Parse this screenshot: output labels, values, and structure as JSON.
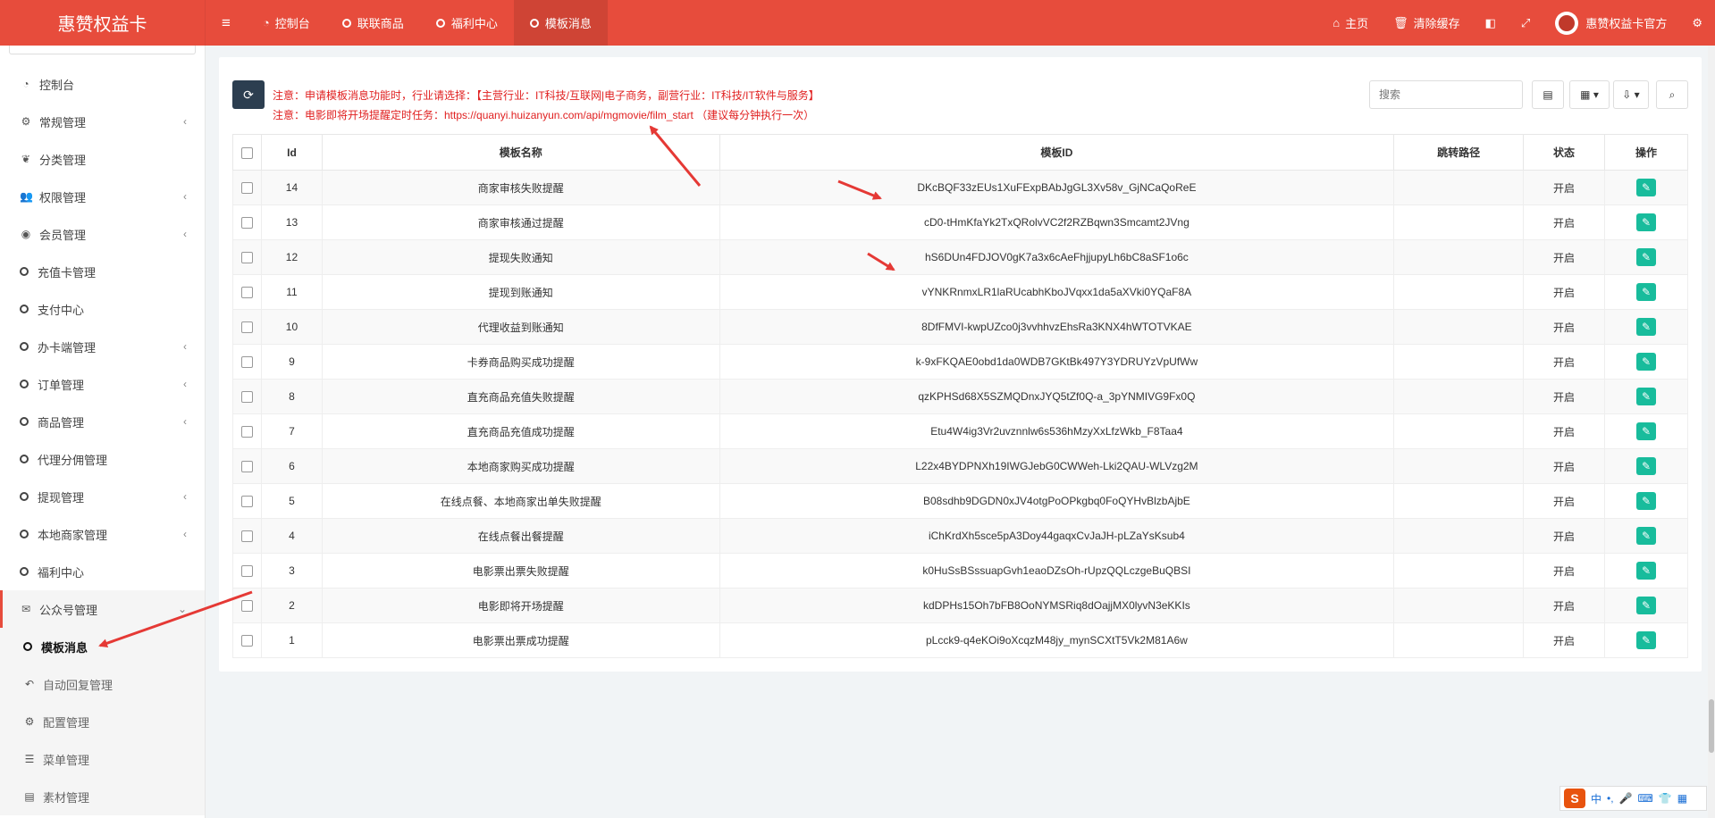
{
  "brand": {
    "title": "惠赞权益卡"
  },
  "topnav": {
    "toggle_icon": "≡",
    "items": [
      {
        "label": "控制台",
        "icon": "dashboard-icon"
      },
      {
        "label": "联联商品",
        "icon": "circle-icon"
      },
      {
        "label": "福利中心",
        "icon": "circle-icon"
      },
      {
        "label": "模板消息",
        "icon": "circle-icon",
        "active": true
      }
    ]
  },
  "topright": {
    "home": "主页",
    "clear_cache": "清除缓存",
    "user_name": "惠赞权益卡官方"
  },
  "sidebar": {
    "items": [
      {
        "label": "控制台",
        "icon": "dashboard-icon",
        "glyph": "◔"
      },
      {
        "label": "常规管理",
        "icon": "cogs-icon",
        "glyph": "⚙",
        "caret": "‹"
      },
      {
        "label": "分类管理",
        "icon": "leaf-icon",
        "glyph": "❦"
      },
      {
        "label": "权限管理",
        "icon": "group-icon",
        "glyph": "👥",
        "caret": "‹"
      },
      {
        "label": "会员管理",
        "icon": "user-circle-icon",
        "glyph": "◉",
        "caret": "‹"
      },
      {
        "label": "充值卡管理",
        "icon": "circle-icon"
      },
      {
        "label": "支付中心",
        "icon": "circle-icon"
      },
      {
        "label": "办卡端管理",
        "icon": "circle-icon",
        "caret": "‹"
      },
      {
        "label": "订单管理",
        "icon": "circle-icon",
        "caret": "‹"
      },
      {
        "label": "商品管理",
        "icon": "circle-icon",
        "caret": "‹"
      },
      {
        "label": "代理分佣管理",
        "icon": "circle-icon"
      },
      {
        "label": "提现管理",
        "icon": "circle-icon",
        "caret": "‹"
      },
      {
        "label": "本地商家管理",
        "icon": "circle-icon",
        "caret": "‹"
      },
      {
        "label": "福利中心",
        "icon": "circle-icon"
      }
    ],
    "open_group": {
      "label": "公众号管理",
      "icon": "wechat-icon",
      "glyph": "✉",
      "caret": "⌄"
    },
    "sub_items": [
      {
        "label": "模板消息",
        "icon": "circle-icon",
        "active": true
      },
      {
        "label": "自动回复管理",
        "icon": "reply-icon",
        "glyph": "↶"
      },
      {
        "label": "配置管理",
        "icon": "cog-icon",
        "glyph": "⚙"
      },
      {
        "label": "菜单管理",
        "icon": "list-icon",
        "glyph": "☰"
      },
      {
        "label": "素材管理",
        "icon": "list-alt-icon",
        "glyph": "▤"
      }
    ]
  },
  "toolbar": {
    "notice1": "注意：申请模板消息功能时，行业请选择：【主营行业：IT科技/互联网|电子商务，副营行业：IT科技/IT软件与服务】",
    "notice2": "注意：电影即将开场提醒定时任务：https://quanyi.huizanyun.com/api/mgmovie/film_start （建议每分钟执行一次）",
    "search_placeholder": "搜索"
  },
  "table": {
    "headers": [
      "Id",
      "模板名称",
      "模板ID",
      "跳转路径",
      "状态",
      "操作"
    ],
    "rows": [
      {
        "id": "14",
        "name": "商家审核失败提醒",
        "tid": "DKcBQF33zEUs1XuFExpBAbJgGL3Xv58v_GjNCaQoReE",
        "path": "",
        "status": "开启"
      },
      {
        "id": "13",
        "name": "商家审核通过提醒",
        "tid": "cD0-tHmKfaYk2TxQRolvVC2f2RZBqwn3Smcamt2JVng",
        "path": "",
        "status": "开启"
      },
      {
        "id": "12",
        "name": "提现失败通知",
        "tid": "hS6DUn4FDJOV0gK7a3x6cAeFhjjupyLh6bC8aSF1o6c",
        "path": "",
        "status": "开启"
      },
      {
        "id": "11",
        "name": "提现到账通知",
        "tid": "vYNKRnmxLR1laRUcabhKboJVqxx1da5aXVki0YQaF8A",
        "path": "",
        "status": "开启"
      },
      {
        "id": "10",
        "name": "代理收益到账通知",
        "tid": "8DfFMVI-kwpUZco0j3vvhhvzEhsRa3KNX4hWTOTVKAE",
        "path": "",
        "status": "开启"
      },
      {
        "id": "9",
        "name": "卡券商品购买成功提醒",
        "tid": "k-9xFKQAE0obd1da0WDB7GKtBk497Y3YDRUYzVpUfWw",
        "path": "",
        "status": "开启"
      },
      {
        "id": "8",
        "name": "直充商品充值失败提醒",
        "tid": "qzKPHSd68X5SZMQDnxJYQ5tZf0Q-a_3pYNMIVG9Fx0Q",
        "path": "",
        "status": "开启"
      },
      {
        "id": "7",
        "name": "直充商品充值成功提醒",
        "tid": "Etu4W4ig3Vr2uvznnlw6s536hMzyXxLfzWkb_F8Taa4",
        "path": "",
        "status": "开启"
      },
      {
        "id": "6",
        "name": "本地商家购买成功提醒",
        "tid": "L22x4BYDPNXh19IWGJebG0CWWeh-Lki2QAU-WLVzg2M",
        "path": "",
        "status": "开启"
      },
      {
        "id": "5",
        "name": "在线点餐、本地商家出单失败提醒",
        "tid": "B08sdhb9DGDN0xJV4otgPoOPkgbq0FoQYHvBlzbAjbE",
        "path": "",
        "status": "开启"
      },
      {
        "id": "4",
        "name": "在线点餐出餐提醒",
        "tid": "iChKrdXh5sce5pA3Doy44gaqxCvJaJH-pLZaYsKsub4",
        "path": "",
        "status": "开启"
      },
      {
        "id": "3",
        "name": "电影票出票失败提醒",
        "tid": "k0HuSsBSssuapGvh1eaoDZsOh-rUpzQQLczgeBuQBSI",
        "path": "",
        "status": "开启"
      },
      {
        "id": "2",
        "name": "电影即将开场提醒",
        "tid": "kdDPHs15Oh7bFB8OoNYMSRiq8dOajjMX0lyvN3eKKIs",
        "path": "",
        "status": "开启"
      },
      {
        "id": "1",
        "name": "电影票出票成功提醒",
        "tid": "pLcck9-q4eKOi9oXcqzM48jy_mynSCXtT5Vk2M81A6w",
        "path": "",
        "status": "开启"
      }
    ]
  },
  "ime": {
    "logo": "S",
    "lang": "中"
  },
  "colors": {
    "topbar": "#e74c3c",
    "refresh": "#2c3e50",
    "edit": "#18bc9c",
    "notice": "#e02020"
  }
}
